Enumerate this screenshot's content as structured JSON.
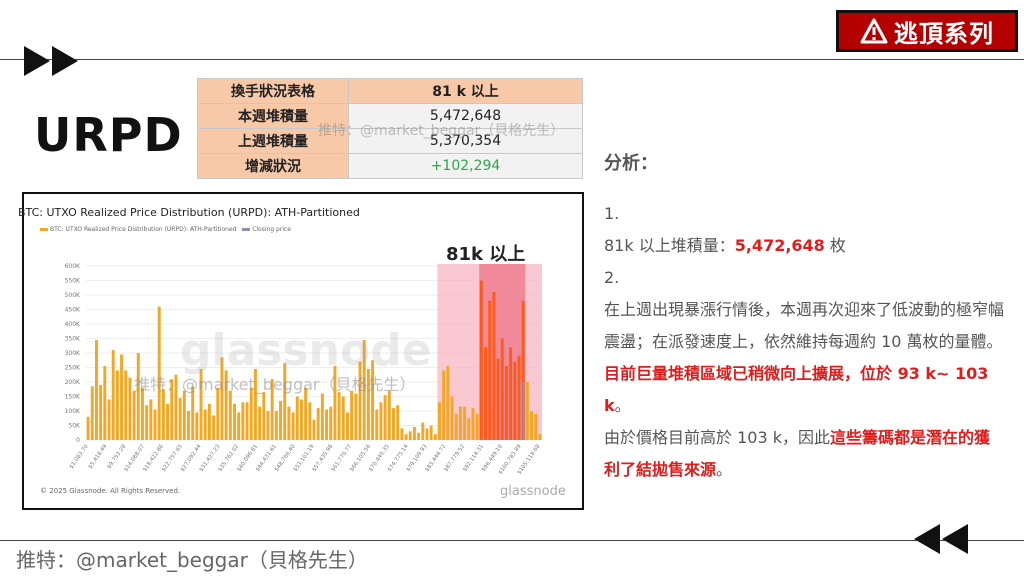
{
  "badge": {
    "text": "逃頂系列"
  },
  "heading": "URPD",
  "table": {
    "header_label": "換手狀況表格",
    "header_value": "81 k 以上",
    "rows": [
      {
        "label": "本週堆積量",
        "value": "5,472,648"
      },
      {
        "label": "上週堆積量",
        "value": "5,370,354"
      },
      {
        "label": "增減狀況",
        "value": "+102,294"
      }
    ]
  },
  "watermarks": {
    "table": "推特：@market_beggar（貝格先生）",
    "chart": "推特：@market_beggar（貝格先生）",
    "glass": "glassnode",
    "footer": "推特：@market_beggar（貝格先生）"
  },
  "chart_meta": {
    "legend_series": "BTC: UTXO Realized Price Distribution (URPD): ATH-Partitioned",
    "legend_close": "Closing price",
    "copyright": "© 2025 Glassnode. All Rights Reserved.",
    "brand": "glassnode",
    "zone_label": "81k 以上"
  },
  "chart_data": {
    "type": "bar",
    "title": "BTC: UTXO Realized Price Distribution (URPD): ATH-Partitioned",
    "ylim": [
      0,
      600000
    ],
    "y_ticks": [
      "0",
      "50K",
      "100K",
      "150K",
      "200K",
      "250K",
      "300K",
      "350K",
      "400K",
      "450K",
      "500K",
      "550K",
      "600K"
    ],
    "x_tick_labels": [
      "$1,083.70",
      "$5,418.49",
      "$9,753.28",
      "$14,088.07",
      "$18,422.86",
      "$22,757.65",
      "$27,092.44",
      "$31,427.23",
      "$35,762.02",
      "$40,096.81",
      "$44,431.61",
      "$48,766.40",
      "$53,101.19",
      "$57,435.98",
      "$61,770.77",
      "$66,105.56",
      "$70,440.35",
      "$74,775.14",
      "$79,109.93",
      "$83,444.72",
      "$87,779.52",
      "$92,114.31",
      "$96,449.10",
      "$100,783.89",
      "$105,118.68"
    ],
    "highlight_range_start_index": 84,
    "strong_highlight_start_index": 94,
    "values": [
      80000,
      185000,
      345000,
      190000,
      255000,
      140000,
      310000,
      240000,
      295000,
      240000,
      215000,
      170000,
      300000,
      180000,
      120000,
      140000,
      105000,
      460000,
      175000,
      125000,
      210000,
      225000,
      145000,
      170000,
      100000,
      185000,
      95000,
      245000,
      105000,
      125000,
      85000,
      180000,
      285000,
      240000,
      170000,
      125000,
      95000,
      130000,
      130000,
      180000,
      245000,
      115000,
      165000,
      100000,
      210000,
      100000,
      135000,
      265000,
      115000,
      95000,
      150000,
      140000,
      180000,
      130000,
      70000,
      110000,
      160000,
      105000,
      115000,
      255000,
      165000,
      150000,
      95000,
      170000,
      160000,
      270000,
      345000,
      245000,
      275000,
      105000,
      130000,
      155000,
      170000,
      110000,
      120000,
      40000,
      20000,
      30000,
      45000,
      25000,
      60000,
      40000,
      50000,
      20000,
      130000,
      240000,
      255000,
      150000,
      90000,
      115000,
      115000,
      75000,
      110000,
      90000,
      550000,
      320000,
      480000,
      510000,
      280000,
      350000,
      255000,
      320000,
      270000,
      290000,
      480000,
      200000,
      100000,
      90000,
      20000
    ]
  },
  "analysis": {
    "heading": "分析：",
    "p1_num": "1.",
    "p1_prefix": "81k 以上堆積量：",
    "p1_value": "5,472,648",
    "p1_suffix": " 枚",
    "p2_num": "2.",
    "p2_text_a": "在上週出現暴漲行情後，本週再次迎來了低波動的極窄幅震盪；在派發速度上，依然維持每週約 10 萬枚的量體。",
    "p2_red_a": "目前巨量堆積區域已稍微向上擴展，位於 93 k~ 103 k",
    "p2_text_b": "。",
    "p3_text_a": "由於價格目前高於 103 k，因此",
    "p3_red": "這些籌碼都是潛在的獲利了結拋售來源",
    "p3_text_b": "。"
  },
  "colors": {
    "bar": "#f5a623",
    "bar_hot": "#ff5a1a",
    "zone": "#f7b6c4",
    "zone_hot": "#ec6f82",
    "closing": "#8d8db4",
    "badge_bg": "#b40000",
    "accent_red": "#e31b1b",
    "positive": "#2aa84a"
  }
}
